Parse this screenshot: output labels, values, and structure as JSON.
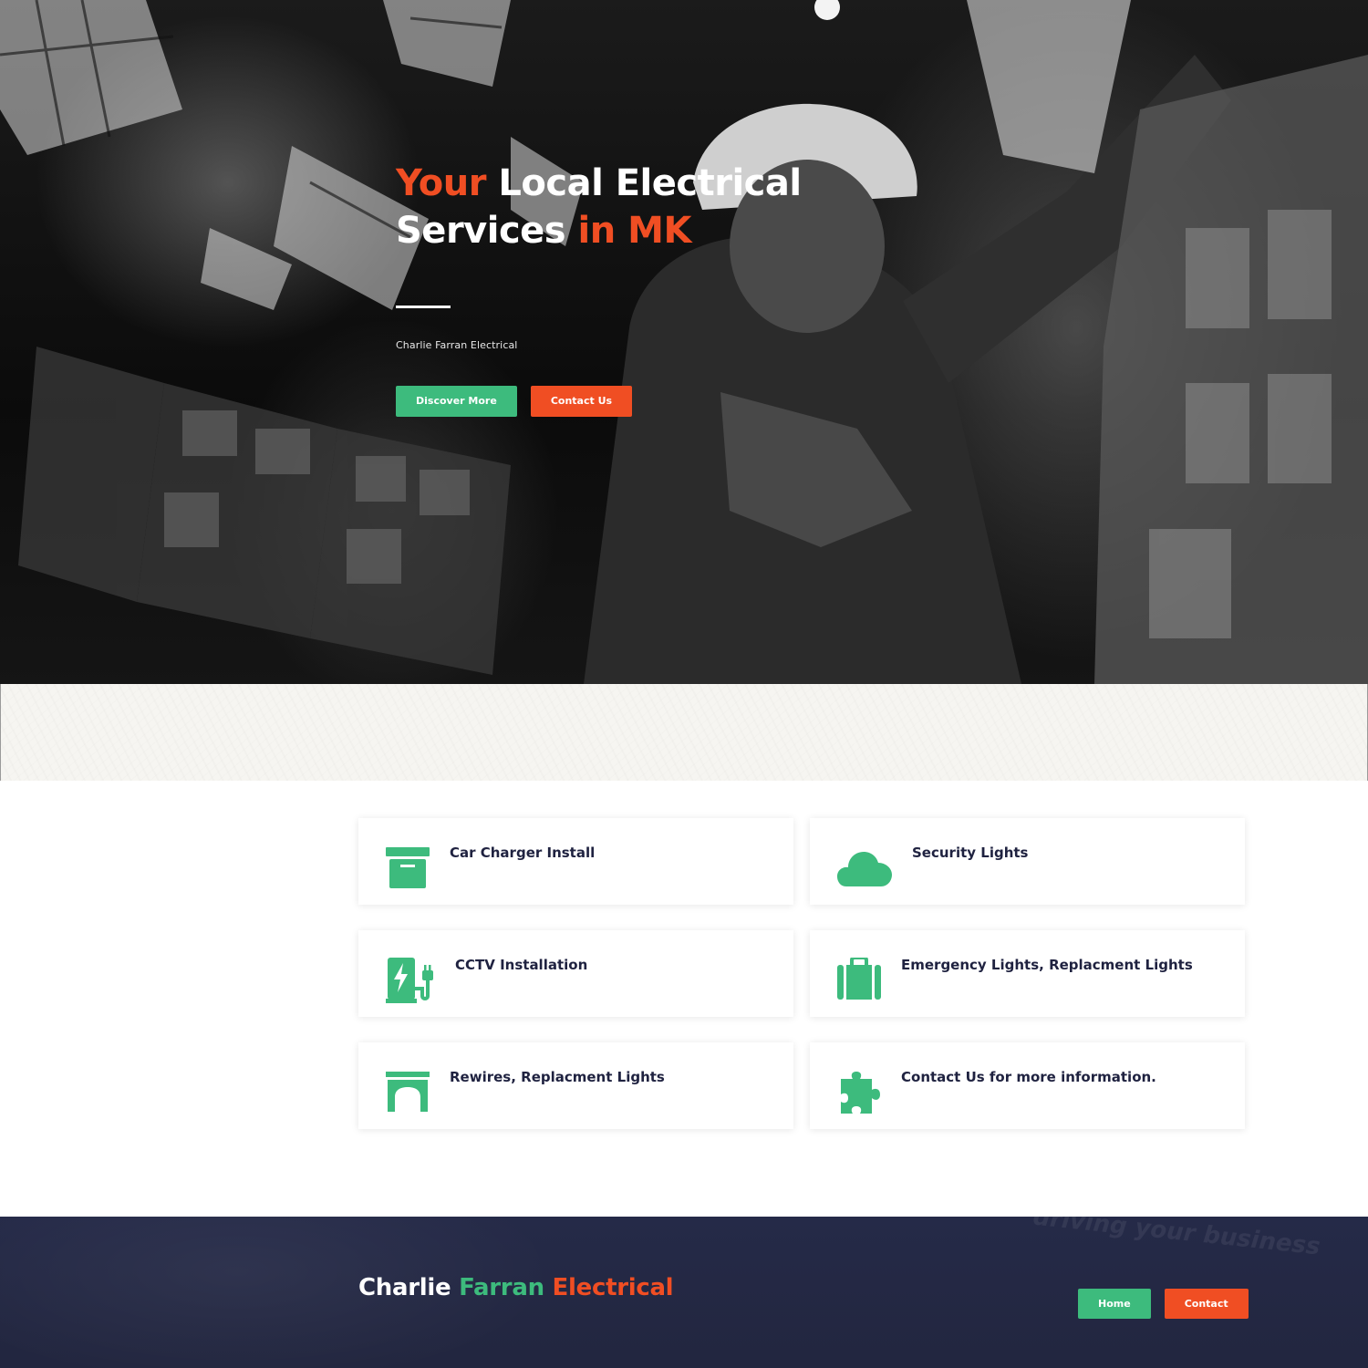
{
  "hero": {
    "title_word1": "Your",
    "title_word2": "Local Electrical",
    "title_word3": "Services",
    "title_word4": "in MK",
    "subtitle": "Charlie Farran Electrical",
    "discover_label": "Discover More",
    "contact_label": "Contact Us"
  },
  "services": [
    {
      "label": "Car Charger Install",
      "icon": "archive-box-icon"
    },
    {
      "label": "Security Lights",
      "icon": "cloud-icon"
    },
    {
      "label": "CCTV Installation",
      "icon": "ev-charger-icon"
    },
    {
      "label": "Emergency Lights, Replacment Lights",
      "icon": "suitcase-icon"
    },
    {
      "label": "Rewires, Replacment Lights",
      "icon": "archway-icon"
    },
    {
      "label": "Contact Us for more information.",
      "icon": "puzzle-piece-icon"
    }
  ],
  "footer": {
    "brand_part1": "Charlie",
    "brand_part2": "Farran",
    "brand_part3": "Electrical",
    "ghost_text": "driving your business",
    "home_label": "Home",
    "contact_label": "Contact"
  },
  "colors": {
    "accent_orange": "#f04e23",
    "accent_green": "#3dbb7d",
    "navy": "#252a48",
    "card_text": "#1f2240"
  }
}
